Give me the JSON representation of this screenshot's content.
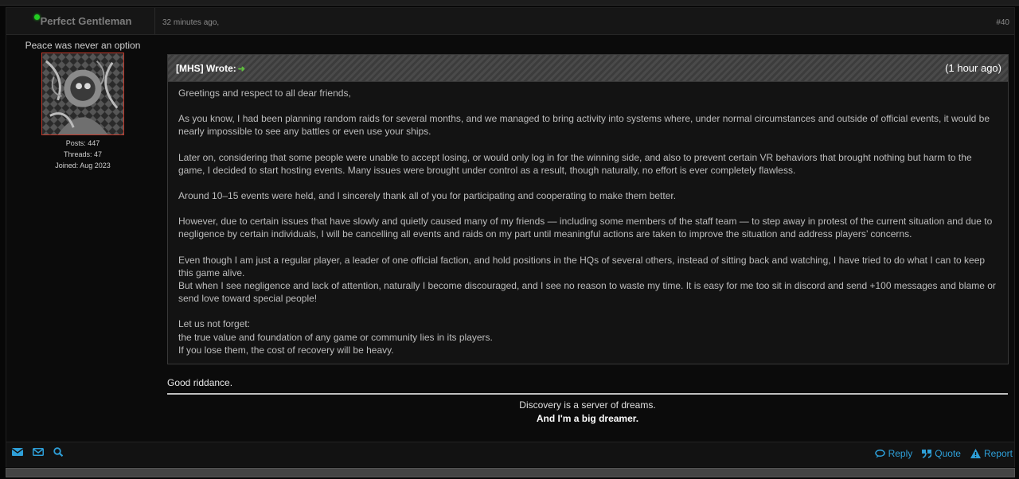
{
  "post": {
    "username": "Perfect Gentleman",
    "date": "32 minutes ago,",
    "number": "#40",
    "user_title": "Peace was never an option",
    "posts": "Posts: 447",
    "threads": "Threads: 47",
    "joined": "Joined: Aug 2023"
  },
  "quote": {
    "author": "[MHS] Wrote:",
    "time": "(1 hour ago)",
    "paragraphs": [
      "Greetings and respect to all dear friends,",
      "As you know, I had been planning random raids for several months, and we managed to bring activity into systems where, under normal circumstances and outside of official events, it would be nearly impossible to see any battles or even use your ships.",
      "Later on, considering that some people were unable to accept losing, or would only log in for the winning side, and also to prevent certain VR behaviors that brought nothing but harm to the game, I decided to start hosting events. Many issues were brought under control as a result, though naturally, no effort is ever completely flawless.",
      "Around 10–15 events were held, and I sincerely thank all of you for participating and cooperating to make them better.",
      "However, due to certain issues that have slowly and quietly caused many of my friends — including some members of the staff team — to step away in protest of the current situation and due to negligence by certain individuals, I will be cancelling all events and raids on my part until meaningful actions are taken to improve the situation and address players’ concerns.",
      "Even though I am just a regular player, a leader of one official faction, and hold positions in the HQs of several others, instead of sitting back and watching, I have tried to do what I can to keep this game alive.",
      "But when I see negligence and lack of attention, naturally I become discouraged, and I see no reason to waste my time. It is easy for me too sit in discord and send +100 messages and blame or send love toward special people!",
      "Let us not forget:",
      "the true value and foundation of any game or community lies in its players.",
      "If you lose them, the cost of recovery will be heavy."
    ]
  },
  "reply": "Good riddance.",
  "signature": {
    "line1": "Discovery is a server of dreams.",
    "line2": "And I'm a big dreamer."
  },
  "footer": {
    "reply_label": "Reply",
    "quote_label": "Quote",
    "report_label": "Report"
  },
  "colors": {
    "accent": "#2e9fd8",
    "online": "#22cc22",
    "avatar_border": "#c0392b"
  }
}
